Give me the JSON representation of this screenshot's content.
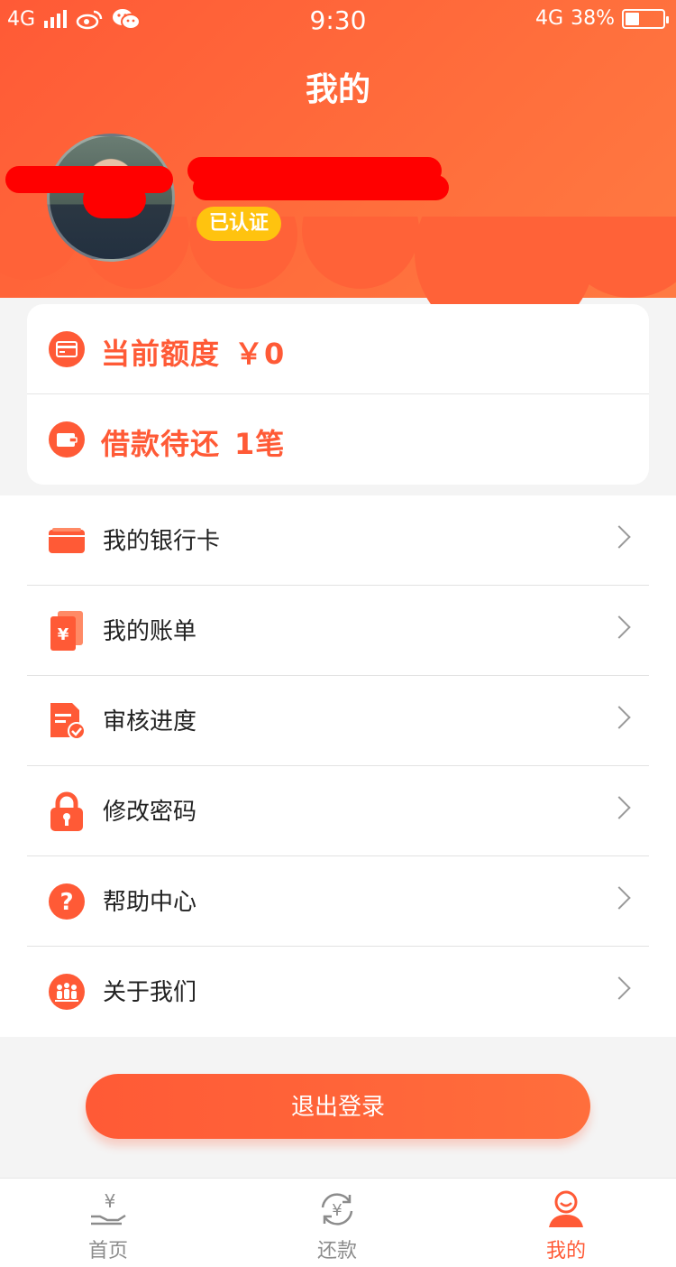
{
  "status_bar": {
    "network_left": "4G",
    "time": "9:30",
    "network_right": "4G",
    "battery": "38%",
    "battery_level": 0.38
  },
  "header": {
    "title": "我的",
    "verified_badge": "已认证"
  },
  "summary": {
    "credit_label": "当前额度",
    "credit_value": "￥0",
    "loan_label": "借款待还",
    "loan_value": "1笔"
  },
  "menu": {
    "items": [
      {
        "label": "我的银行卡",
        "icon": "bank-card-icon"
      },
      {
        "label": "我的账单",
        "icon": "bill-icon"
      },
      {
        "label": "审核进度",
        "icon": "review-progress-icon"
      },
      {
        "label": "修改密码",
        "icon": "lock-icon"
      },
      {
        "label": "帮助中心",
        "icon": "help-icon"
      },
      {
        "label": "关于我们",
        "icon": "about-us-icon"
      }
    ]
  },
  "logout_label": "退出登录",
  "tabbar": {
    "items": [
      {
        "label": "首页",
        "icon": "home-yuan-icon",
        "active": false
      },
      {
        "label": "还款",
        "icon": "repay-icon",
        "active": false
      },
      {
        "label": "我的",
        "icon": "profile-icon",
        "active": true
      }
    ]
  },
  "colors": {
    "accent": "#ff5a36",
    "badge": "#ffc30f",
    "redaction": "#ff0000"
  }
}
